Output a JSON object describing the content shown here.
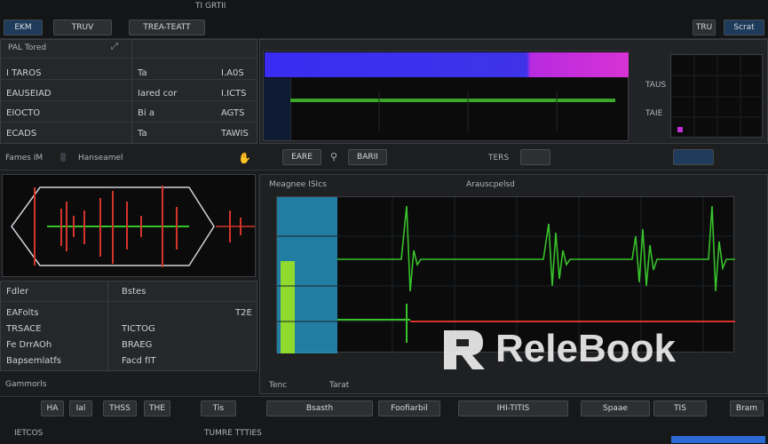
{
  "toolbar": {
    "items": [
      "EKM",
      "TRUV",
      "TREA-TEATT",
      "TI GRTII"
    ],
    "right_items": [
      "TRU",
      "Scrat"
    ]
  },
  "left_panel": {
    "header": "PAL Tored",
    "rows": [
      {
        "a": "I TAROS",
        "b": "Ta",
        "c": "I.A0S"
      },
      {
        "a": "EAUSEIAD",
        "b": "Iared cor",
        "c": "I.ICTS"
      },
      {
        "a": "EIOCTO",
        "b": "Bi a",
        "c": "AGTS"
      },
      {
        "a": "ECADS",
        "b": "Ta",
        "c": "TAWIS"
      }
    ]
  },
  "top_display": {
    "labels_right": [
      "TAUS",
      "TAIE"
    ],
    "footer_left": "EARE",
    "footer_mid": "BARII",
    "footer_right": "TERS",
    "bar_colors": [
      "#2d2cf0",
      "#c42fd8"
    ]
  },
  "channel_bar": {
    "label": "Fames IM",
    "value": "Hanseamel"
  },
  "waveform_panel": {
    "title": "Arauscpelsd",
    "sub": "Meagnee ISIcs"
  },
  "left_info": {
    "header_a": "Fdler",
    "header_b": "Bstes",
    "rows": [
      {
        "a": "EAFolts",
        "b": ""
      },
      {
        "a": "TRSACE",
        "b": "TICTOG"
      },
      {
        "a": "Fe DrrAOh",
        "b": "BRAEG"
      },
      {
        "a": "Bapsemlatfs",
        "b": "Facd fIT"
      }
    ],
    "corner": "T2E"
  },
  "bottom_left_label": "Gammorls",
  "bottom_panel_labels": [
    "Tenc",
    "Tarat"
  ],
  "bottom_bar": {
    "buttons": [
      "HA",
      "Ial",
      "THSS",
      "THE",
      "Tis",
      "Bsasth",
      "Foofiarbil",
      "IHI-TITIS",
      "Spaae",
      "TIS",
      "Bram"
    ],
    "status_left": "IETCOS",
    "status_mid": "TUMRE TTTIES"
  },
  "watermark_brand": "ReleBook",
  "colors": {
    "waveform_green": "#37c12a",
    "waveform_red": "#d4342a",
    "accent_blue": "#2d6bd4",
    "cyan_segment": "#2aa4d4",
    "lime_segment": "#8fda2c"
  }
}
